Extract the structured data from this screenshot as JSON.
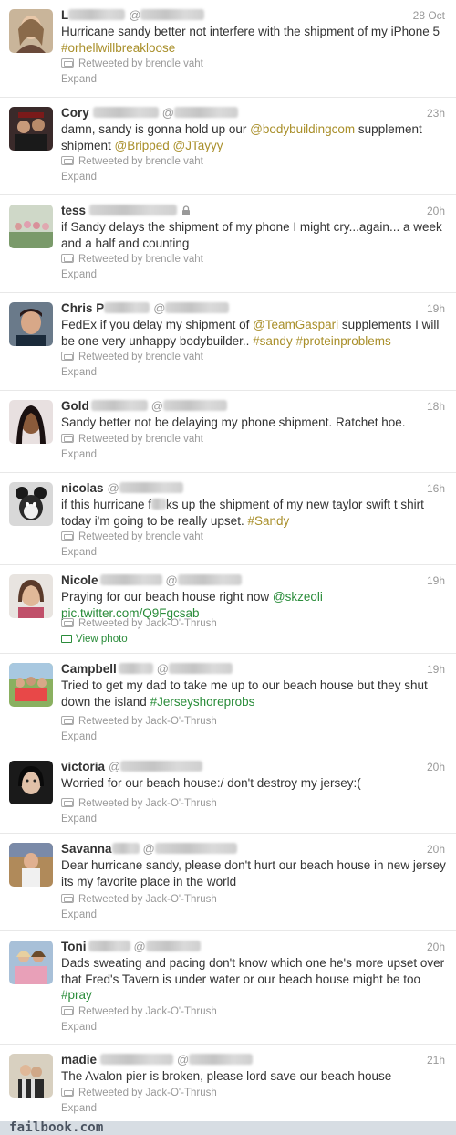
{
  "tweets": [
    {
      "name": "L",
      "at": "@",
      "time": "28 Oct",
      "text": [
        {
          "t": "Hurricane sandy better not interfere with the shipment of my iPhone 5 "
        },
        {
          "t": "#orhellwillbreakloose",
          "k": "ht"
        }
      ],
      "retweeted_by": "Retweeted by brendle vaht",
      "action": "Expand"
    },
    {
      "name": "Cory",
      "at": "@",
      "time": "23h",
      "text": [
        {
          "t": "damn, sandy is gonna hold up our "
        },
        {
          "t": "@bodybuildingcom",
          "k": "mn"
        },
        {
          "t": " supplement shipment      "
        },
        {
          "t": "@Bripped",
          "k": "mn"
        },
        {
          "t": " "
        },
        {
          "t": "@JTayyy",
          "k": "mn"
        }
      ],
      "retweeted_by": "Retweeted by brendle vaht",
      "action": "Expand"
    },
    {
      "name": "tess",
      "at": "",
      "time": "20h",
      "locked": true,
      "text": [
        {
          "t": "if Sandy delays the shipment of my phone I might cry...again... a week and a half and counting"
        }
      ],
      "retweeted_by": "Retweeted by brendle vaht",
      "action": "Expand"
    },
    {
      "name": "Chris P",
      "at": "@",
      "time": "19h",
      "text": [
        {
          "t": "FedEx if you delay my shipment of "
        },
        {
          "t": "@TeamGaspari",
          "k": "mn"
        },
        {
          "t": " supplements I will be one very unhappy bodybuilder.. "
        },
        {
          "t": "#sandy",
          "k": "ht"
        },
        {
          "t": " "
        },
        {
          "t": "#proteinproblems",
          "k": "ht"
        }
      ],
      "retweeted_by": "Retweeted by brendle vaht",
      "action": "Expand"
    },
    {
      "name": "Gold",
      "at": "@",
      "time": "18h",
      "text": [
        {
          "t": "Sandy better not be delaying my phone shipment. Ratchet hoe."
        }
      ],
      "retweeted_by": "Retweeted by brendle vaht",
      "action": "Expand"
    },
    {
      "name": "nicolas",
      "at": "@",
      "time": "16h",
      "text": [
        {
          "t": "if this hurricane f"
        },
        {
          "t": "██",
          "k": "cen"
        },
        {
          "t": "ks up the shipment of my new taylor swift t shirt today i'm going to be really upset. "
        },
        {
          "t": "#Sandy",
          "k": "ht"
        }
      ],
      "retweeted_by": "Retweeted by brendle vaht",
      "action": "Expand"
    },
    {
      "name": "Nicole",
      "at": "@",
      "time": "19h",
      "text": [
        {
          "t": "Praying for our beach house right now      "
        },
        {
          "t": "@skzeoli",
          "k": "mn blue"
        },
        {
          "t": " "
        },
        {
          "t": "pic.twitter.com/Q9Fgcsab",
          "k": "lk"
        }
      ],
      "retweeted_by": "Retweeted by Jack-O'-Thrush",
      "action": "View photo",
      "photo": true
    },
    {
      "name": "Campbell",
      "at": "@",
      "time": "19h",
      "text": [
        {
          "t": "Tried to get my dad to take me up to our beach house but they shut down the island "
        },
        {
          "t": "#Jerseyshoreprobs",
          "k": "ht blue"
        }
      ],
      "retweeted_by": "Retweeted by Jack-O'-Thrush",
      "action": "Expand"
    },
    {
      "name": "victoria",
      "at": "@",
      "time": "20h",
      "text": [
        {
          "t": "Worried for our beach house:/ don't destroy my jersey:("
        }
      ],
      "retweeted_by": "Retweeted by Jack-O'-Thrush",
      "action": "Expand"
    },
    {
      "name": "Savanna",
      "at": "@",
      "time": "20h",
      "text": [
        {
          "t": "Dear hurricane sandy, please don't hurt our beach house in new jersey its my favorite place in the world"
        }
      ],
      "retweeted_by": "Retweeted by Jack-O'-Thrush",
      "action": "Expand"
    },
    {
      "name": "Toni",
      "at": "@",
      "time": "20h",
      "text": [
        {
          "t": "Dads sweating and pacing don't know which one he's more upset over that Fred's Tavern is under water or our beach house might be too "
        },
        {
          "t": "#pray",
          "k": "ht blue"
        }
      ],
      "retweeted_by": "Retweeted by Jack-O'-Thrush",
      "action": "Expand"
    },
    {
      "name": "madie",
      "at": "@",
      "time": "21h",
      "text": [
        {
          "t": "The Avalon pier is broken, please lord save our beach house"
        }
      ],
      "retweeted_by": "Retweeted by Jack-O'-Thrush",
      "action": "Expand"
    }
  ],
  "footer": {
    "brand": "failbook.com"
  },
  "colors": {
    "hashtag": "#a98f2a",
    "link_green": "#2a8c3a",
    "meta": "#999999"
  }
}
